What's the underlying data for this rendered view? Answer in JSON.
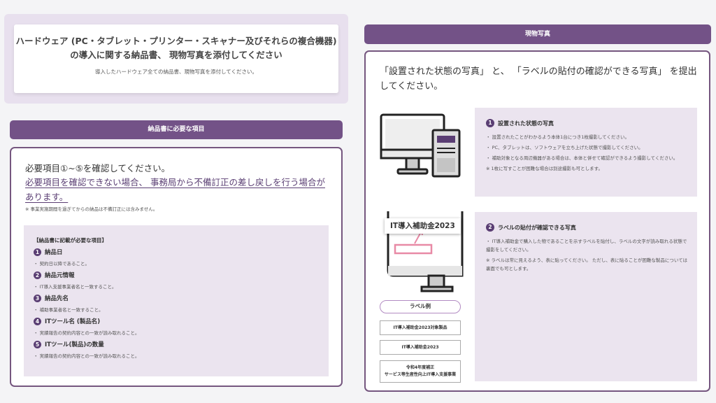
{
  "top": {
    "title_line1": "ハードウェア (PC・タブレット・プリンター・スキャナー及びそれらの複合機器)",
    "title_line2": "の導入に関する納品書、 現物写真を添付してください",
    "subtitle": "導入したハードウェア全ての納品書、現物写真を添付してください。"
  },
  "left": {
    "header": "納品書に必要な項目",
    "line1": "必要項目①~⑤を確認してください。",
    "line2": "必要項目を確認できない場合、 事務局から不備訂正の差し戻しを行う場合があります。",
    "note": "※ 事業実施期間を過ぎてからの納品は不備訂正には含みません。",
    "req_title": "【納品書に記載が必要な項目】",
    "items": [
      {
        "num": "1",
        "name": "納品日",
        "desc": "・ 契約日以降であること。"
      },
      {
        "num": "2",
        "name": "納品元情報",
        "desc": "・ IT導入支援事業者名と一致すること。"
      },
      {
        "num": "3",
        "name": "納品先名",
        "desc": "・ 補助事業者名と一致すること。"
      },
      {
        "num": "4",
        "name": "ITツール名 (製品名)",
        "desc": "・ 実績報告の契約内容との一致が読み取れること。"
      },
      {
        "num": "5",
        "name": "ITツール(製品)の数量",
        "desc": "・ 実績報告の契約内容との一致が読み取れること。"
      }
    ]
  },
  "right": {
    "header": "現物写真",
    "title": "「設置された状態の写真」 と、 「ラベルの貼付の確認ができる写真」 を提出してください。",
    "box1": {
      "num": "1",
      "title": "設置された状態の写真",
      "lines": [
        "・ 設置されたことがわかるよう本体1台につき1枚撮影してください。",
        "・ PC、タブレットは、ソフトウェアを立ち上げた状態で撮影してください。",
        "・ 補助対象となる周辺機器がある場合は、本体と併せて確認ができるよう撮影してください。",
        "※ 1枚に写すことが困難な場合は別途撮影も可とします。"
      ]
    },
    "box2": {
      "num": "2",
      "title": "ラベルの貼付が確認できる写真",
      "lines": [
        "・ IT導入補助金で購入した物であることを示すラベルを貼付し、ラベルの文字が読み取れる状態で撮影をしてください。",
        "※ ラベルは常に見えるよう、表に貼ってください。 ただし、表に貼ることが困難な製品については裏面でも可とします。"
      ]
    },
    "label_tag": "IT導入補助金2023",
    "label_example": "ラベル例",
    "examples": [
      "IT導入補助金2023対象製品",
      "IT導入補助金2023"
    ],
    "example3_line1": "令和4年度補正",
    "example3_line2": "サービス等生産性向上IT導入支援事業"
  },
  "colors": {
    "accent": "#735287",
    "panel_bg": "#ebe4ef",
    "label_pink": "#e88aa6"
  }
}
